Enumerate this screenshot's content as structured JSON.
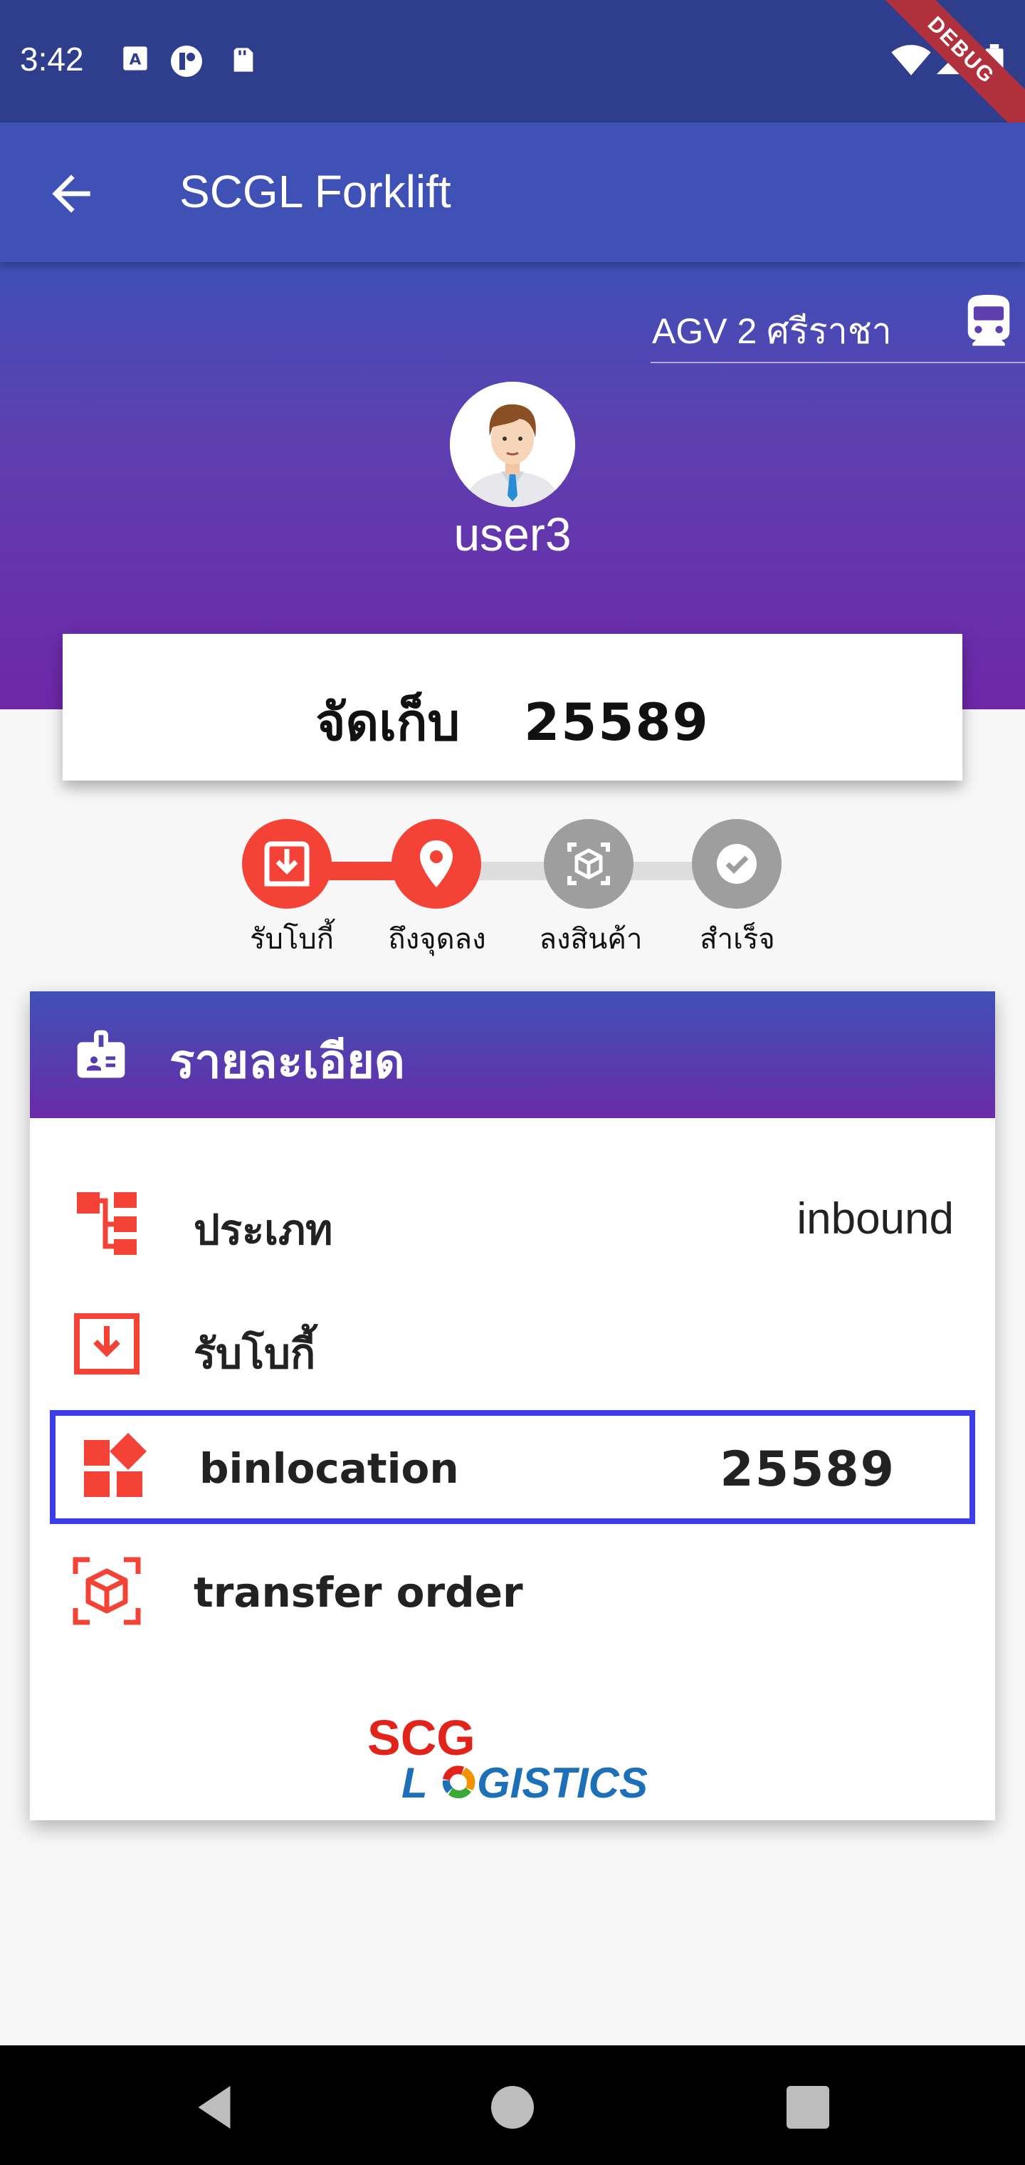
{
  "status_bar": {
    "time": "3:42",
    "debug_label": "DEBUG",
    "icons": [
      "text-icon",
      "app-icon",
      "sd-card-icon",
      "wifi-icon",
      "signal-icon",
      "battery-icon"
    ]
  },
  "app_bar": {
    "title": "SCGL Forklift",
    "back_icon": "arrow-back-icon"
  },
  "agv": {
    "selected": "AGV 2 ศรีราชา",
    "icon": "train-icon"
  },
  "user": {
    "name": "user3"
  },
  "job": {
    "label": "จัดเก็บ",
    "number": "25589"
  },
  "stepper": {
    "steps": [
      {
        "label": "รับโบกี้",
        "icon": "download-icon",
        "done": true
      },
      {
        "label": "ถึงจุดลง",
        "icon": "location-pin-icon",
        "done": true
      },
      {
        "label": "ลงสินค้า",
        "icon": "box-scan-icon",
        "done": false
      },
      {
        "label": "สำเร็จ",
        "icon": "check-circle-icon",
        "done": false
      }
    ]
  },
  "details": {
    "title": "รายละเอียด",
    "rows": [
      {
        "label": "ประเภท",
        "value": "inbound",
        "icon": "hierarchy-icon"
      },
      {
        "label": "รับโบกี้",
        "value": "",
        "icon": "download-icon"
      },
      {
        "label": "binlocation",
        "value": "25589",
        "icon": "widgets-icon"
      },
      {
        "label": "transfer order",
        "value": "",
        "icon": "box-scan-icon"
      }
    ]
  },
  "logo": {
    "line1": "SCG",
    "line2_a": "L",
    "line2_b": "GISTICS"
  },
  "colors": {
    "primary": "#3f51b5",
    "status_bar": "#2e3e8c",
    "purple": "#6e27a8",
    "accent_red": "#f44336",
    "inactive_grey": "#9e9e9e",
    "highlight_blue": "#3c3ce8"
  }
}
